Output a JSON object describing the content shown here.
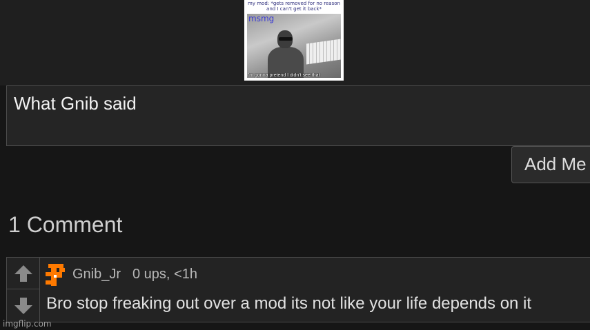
{
  "meme": {
    "caption": "my mod: *gets removed for no reason and I can't get it back*",
    "tag": "msmg",
    "bottom_text": "I'm gonna pretend I didn't see that",
    "image_icon": "meme-image"
  },
  "reply": {
    "value": "What Gnib said",
    "button_label": "Add Me"
  },
  "comments_header": "1 Comment",
  "comments": [
    {
      "username": "Gnib_Jr",
      "meta": "0 ups, <1h",
      "text": "Bro stop freaking out over a mod its not like your life depends on it",
      "avatar_color": "#ff7a00"
    }
  ],
  "watermark": "imgflip.com",
  "colors": {
    "background": "#161616",
    "panel": "#232323",
    "border": "#4a4a4a",
    "avatar": "#ff7a00"
  }
}
